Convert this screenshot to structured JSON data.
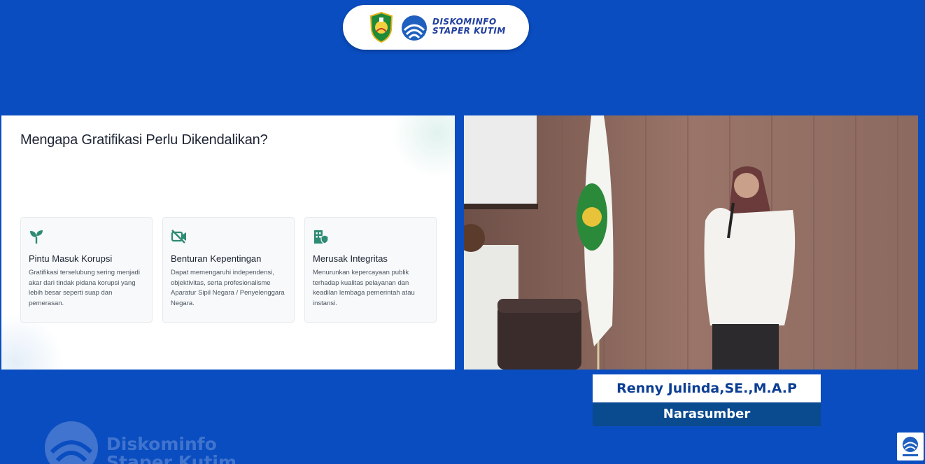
{
  "header": {
    "brand_line1": "DISKOMINFO",
    "brand_line2": "STAPER KUTIM"
  },
  "slide": {
    "title": "Mengapa Gratifikasi Perlu Dikendalikan?",
    "cards": [
      {
        "icon": "sprout-icon",
        "title": "Pintu Masuk Korupsi",
        "body": "Gratifikasi terselubung sering menjadi akar dari tindak pidana korupsi yang lebih besar seperti suap dan pemerasan."
      },
      {
        "icon": "video-off-icon",
        "title": "Benturan Kepentingan",
        "body": "Dapat memengaruhi independensi, objektivitas, serta profesionalisme Aparatur Sipil Negara / Penyelenggara Negara."
      },
      {
        "icon": "building-shield-icon",
        "title": "Merusak Integritas",
        "body": "Menurunkan kepercayaan publik terhadap kualitas pelayanan dan keadilan lembaga pemerintah atau instansi."
      }
    ],
    "accent_color": "#2e8b74"
  },
  "speaker": {
    "name": "Renny Julinda,SE.,M.A.P",
    "role": "Narasumber"
  },
  "watermark": {
    "line1": "Diskominfo",
    "line2": "Staper Kutim"
  },
  "colors": {
    "background": "#0a4dc0",
    "name_text": "#0b3d93",
    "role_bg": "#0a4a8f"
  }
}
